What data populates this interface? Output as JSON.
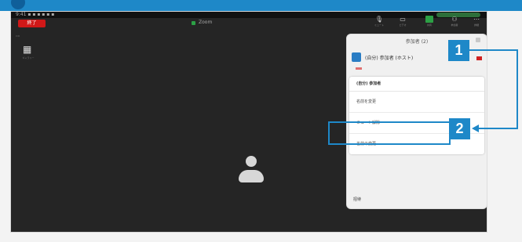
{
  "statusbar": {
    "left_text": "9:41 ▪ ▪ ▪ ▪ ▪ ▪"
  },
  "toolbar": {
    "end_label": "終了",
    "meeting_title": "Zoom",
    "mute_label": "ミュート",
    "video_label": "ビデオ",
    "share_label": "共有",
    "participants_label": "参加者",
    "more_label": "詳細"
  },
  "sidebar": {
    "label": "ギャラリー"
  },
  "panel": {
    "title": "参加者 (2)",
    "user_name": "(自分) 参加者 (ホスト)",
    "menu_header": "(自分) 参加者",
    "menu_items": [
      "名前を変更",
      "ミュート解除",
      "名前の変更"
    ],
    "footer": "招待"
  },
  "callouts": {
    "one": "1",
    "two": "2"
  },
  "colors": {
    "accent": "#1e88c8",
    "end_red": "#d01818",
    "green": "#2ca045"
  }
}
